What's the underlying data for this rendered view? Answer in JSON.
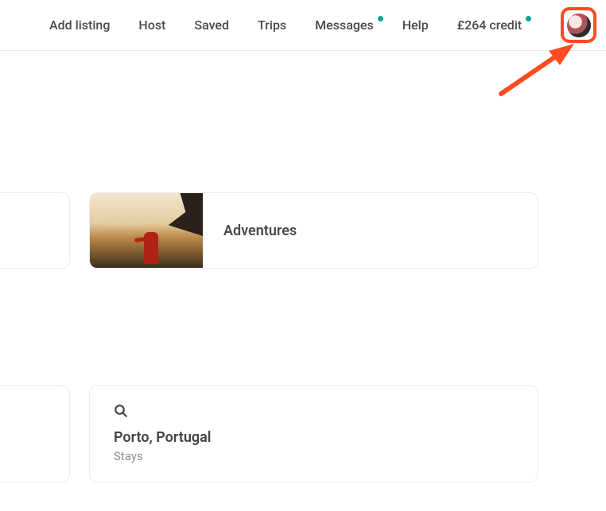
{
  "nav": {
    "add_listing": "Add listing",
    "host": "Host",
    "saved": "Saved",
    "trips": "Trips",
    "messages": "Messages",
    "help": "Help",
    "credit": "£264 credit"
  },
  "cards": {
    "adventures": {
      "title": "Adventures"
    }
  },
  "search": {
    "title": "Porto, Portugal",
    "sub": "Stays"
  }
}
